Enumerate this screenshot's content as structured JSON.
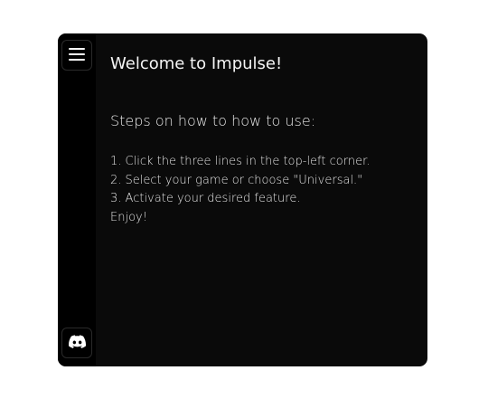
{
  "sidebar": {
    "menu_icon": "hamburger-menu-icon",
    "discord_icon": "discord-icon"
  },
  "main": {
    "title": "Welcome to Impulse!",
    "subtitle": "Steps on how to how to use:",
    "steps": [
      "1. Click the three lines in the top-left corner.",
      "2. Select your game or choose \"Universal.\"",
      "3. Activate your desired feature.",
      "Enjoy!"
    ]
  },
  "colors": {
    "window_bg": "#0a0a0a",
    "sidebar_bg": "#000000",
    "text": "#ffffff"
  }
}
